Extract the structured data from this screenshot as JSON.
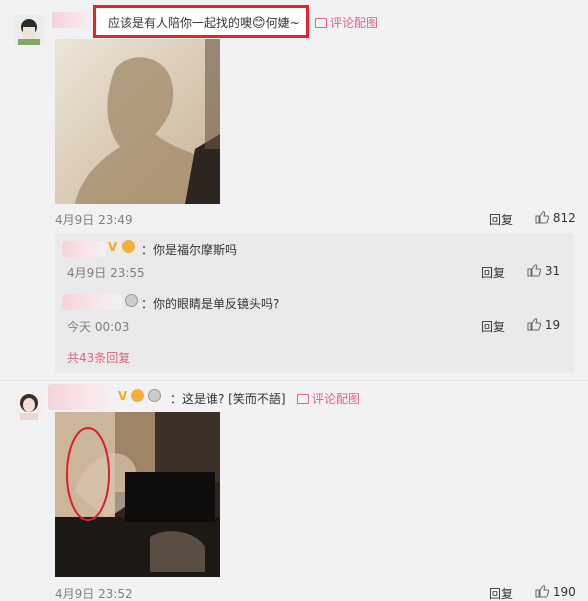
{
  "comments": [
    {
      "text_before": "应该是有人陪你一起找的噢",
      "text_after": "何婕~",
      "emoji": "😊",
      "img_link": "评论配图",
      "time": "4月9日 23:49",
      "reply_label": "回复",
      "likes": "812",
      "replies": [
        {
          "text": "：你是福尔摩斯吗",
          "time": "4月9日 23:55",
          "reply_label": "回复",
          "likes": "31"
        },
        {
          "text": "：你的眼睛是单反镜头吗?",
          "time": "今天 00:03",
          "reply_label": "回复",
          "likes": "19"
        }
      ],
      "more_replies": "共43条回复"
    },
    {
      "text": "：这是谁? [笑而不語]",
      "img_link": "评论配图",
      "time": "4月9日 23:52",
      "reply_label": "回复",
      "likes": "190"
    }
  ],
  "colors": {
    "highlight_border": "#e8242b",
    "link": "#eb7350",
    "background": "#f2f1f4"
  }
}
